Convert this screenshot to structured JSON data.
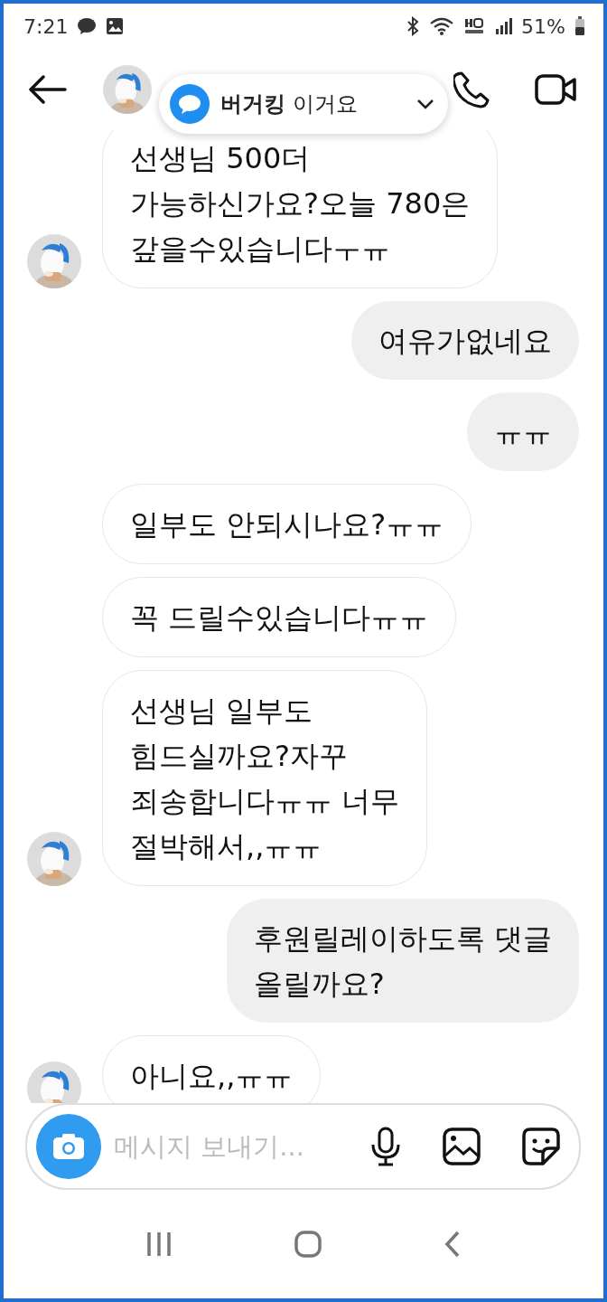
{
  "status_bar": {
    "time": "7:21",
    "battery": "51%"
  },
  "notification": {
    "text": "**버거킹** 이거요"
  },
  "messages": [
    {
      "kind": "received",
      "text": "선생님 500더\n가능하신가요?오늘 780은\n갚을수있습니다ㅜㅠ",
      "avatar": true
    },
    {
      "kind": "sent",
      "text": "여유가없네요"
    },
    {
      "kind": "sent",
      "text": "ㅠㅠ"
    },
    {
      "kind": "received",
      "text": "일부도 안되시나요?ㅠㅠ",
      "avatar": false
    },
    {
      "kind": "received",
      "text": "꼭 드릴수있습니다ㅠㅠ",
      "avatar": false
    },
    {
      "kind": "received",
      "text": "선생님 일부도\n힘드실까요?자꾸\n죄송합니다ㅠㅠ 너무\n절박해서,,ㅠㅠ",
      "avatar": true
    },
    {
      "kind": "sent",
      "text": "후원릴레이하도록 댓글\n올릴까요?"
    },
    {
      "kind": "received",
      "text": "아니요,,ㅠㅠ",
      "avatar": true
    }
  ],
  "composer": {
    "placeholder": "메시지 보내기..."
  }
}
